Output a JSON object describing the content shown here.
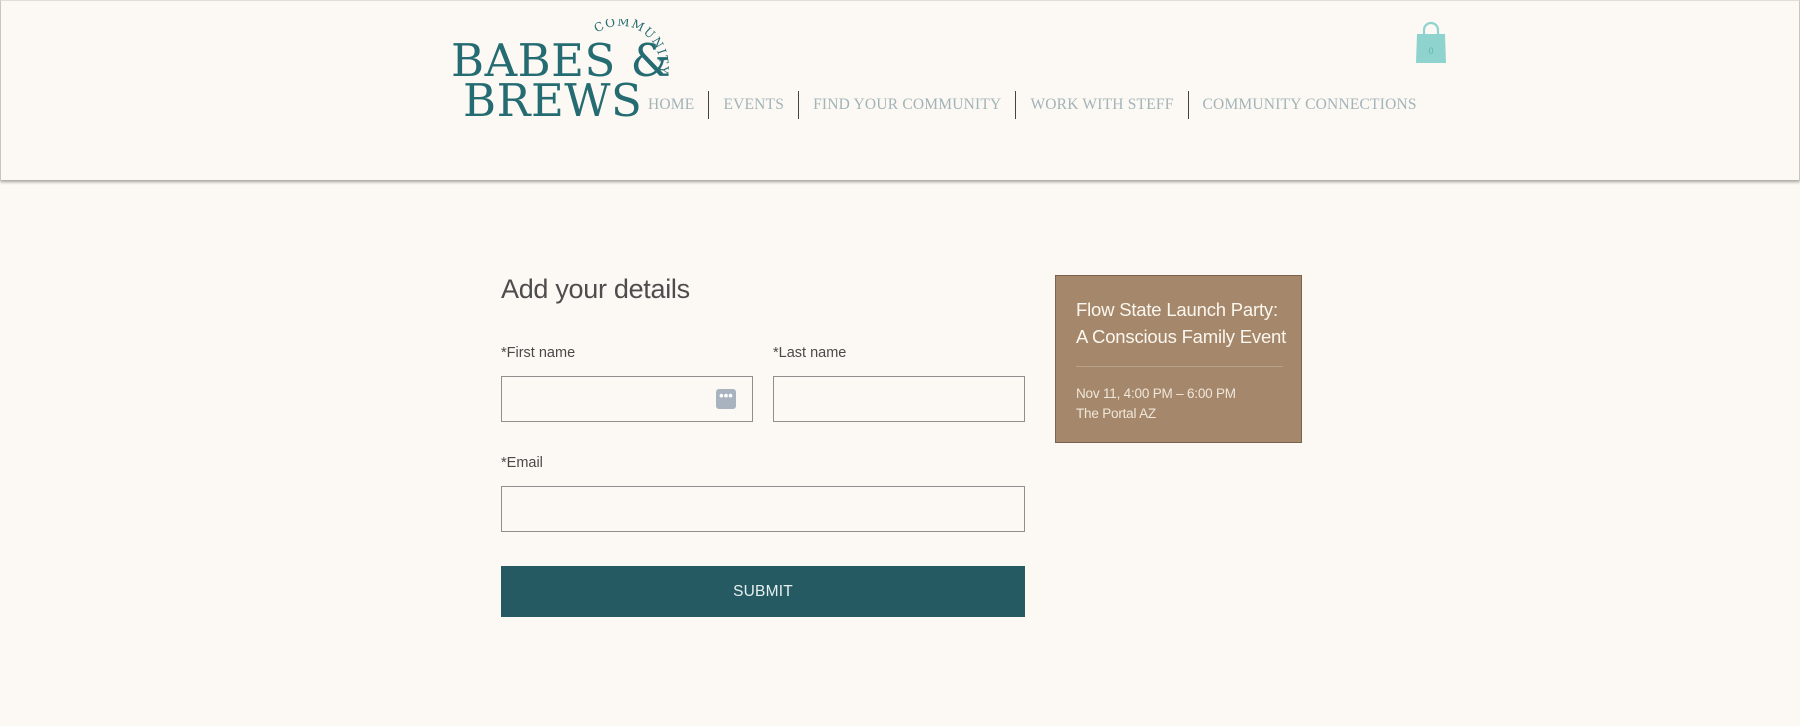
{
  "brand": {
    "line1": "BABES &",
    "line2": "BREWS",
    "arc_text": "COMMUNITY",
    "color": "#256b72"
  },
  "nav": {
    "items": [
      {
        "label": "HOME"
      },
      {
        "label": "EVENTS"
      },
      {
        "label": "FIND YOUR COMMUNITY"
      },
      {
        "label": "WORK WITH STEFF"
      },
      {
        "label": "COMMUNITY CONNECTIONS"
      }
    ]
  },
  "cart": {
    "icon": "shopping-bag-icon",
    "count": "0",
    "color": "#8fd3cf"
  },
  "form": {
    "title": "Add your details",
    "first_name_label": "*First name",
    "first_name_value": "",
    "last_name_label": "*Last name",
    "last_name_value": "",
    "email_label": "*Email",
    "email_value": "",
    "autofill_icon": "autofill-icon",
    "autofill_glyph": "•••",
    "submit_label": "SUBMIT",
    "submit_color": "#265a63"
  },
  "event_card": {
    "title": "Flow State Launch Party: A Conscious Family Event",
    "datetime": "Nov 11, 4:00 PM – 6:00 PM",
    "location": "The Portal AZ",
    "background": "#a5886b"
  }
}
